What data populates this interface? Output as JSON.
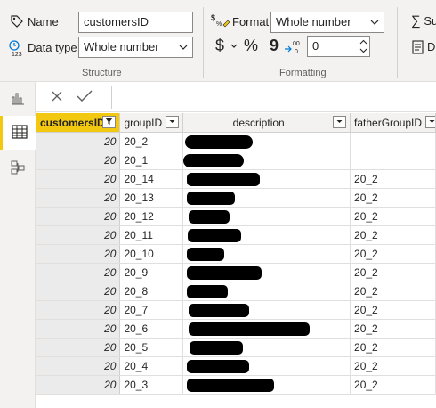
{
  "ribbon": {
    "structure": {
      "name_label": "Name",
      "name_value": "customersID",
      "datatype_label": "Data type",
      "datatype_value": "Whole number",
      "group_label": "Structure"
    },
    "formatting": {
      "format_label": "Format",
      "format_value": "Whole number",
      "currency_symbol": "$",
      "percent_symbol": "%",
      "comma_symbol": "9",
      "decimals_value": "0",
      "group_label": "Formatting"
    },
    "properties": {
      "summarize_partial": "Su",
      "datacategory_partial": "D"
    }
  },
  "grid": {
    "columns": [
      "customersID",
      "groupID",
      "description",
      "fatherGroupID"
    ],
    "rows": [
      {
        "customersID": "20",
        "groupID": "20_2",
        "fatherGroupID": ""
      },
      {
        "customersID": "20",
        "groupID": "20_1",
        "fatherGroupID": ""
      },
      {
        "customersID": "20",
        "groupID": "20_14",
        "fatherGroupID": "20_2"
      },
      {
        "customersID": "20",
        "groupID": "20_13",
        "fatherGroupID": "20_2"
      },
      {
        "customersID": "20",
        "groupID": "20_12",
        "fatherGroupID": "20_2"
      },
      {
        "customersID": "20",
        "groupID": "20_11",
        "fatherGroupID": "20_2"
      },
      {
        "customersID": "20",
        "groupID": "20_10",
        "fatherGroupID": "20_2"
      },
      {
        "customersID": "20",
        "groupID": "20_9",
        "fatherGroupID": "20_2"
      },
      {
        "customersID": "20",
        "groupID": "20_8",
        "fatherGroupID": "20_2"
      },
      {
        "customersID": "20",
        "groupID": "20_7",
        "fatherGroupID": "20_2"
      },
      {
        "customersID": "20",
        "groupID": "20_6",
        "fatherGroupID": "20_2"
      },
      {
        "customersID": "20",
        "groupID": "20_5",
        "fatherGroupID": "20_2"
      },
      {
        "customersID": "20",
        "groupID": "20_4",
        "fatherGroupID": "20_2"
      },
      {
        "customersID": "20",
        "groupID": "20_3",
        "fatherGroupID": "20_2"
      }
    ]
  },
  "colors": {
    "accent": "#f2c811",
    "ribbon_bg": "#f3f2f1",
    "redaction": "#000000"
  },
  "icons": {
    "name": "tag-icon",
    "datatype": "datatype-123-icon",
    "format": "format-currency-icon",
    "cancel": "close-icon",
    "commit": "check-icon",
    "report_view": "bar-chart-icon",
    "data_view": "table-icon",
    "model_view": "model-icon",
    "filter": "filter-icon"
  }
}
